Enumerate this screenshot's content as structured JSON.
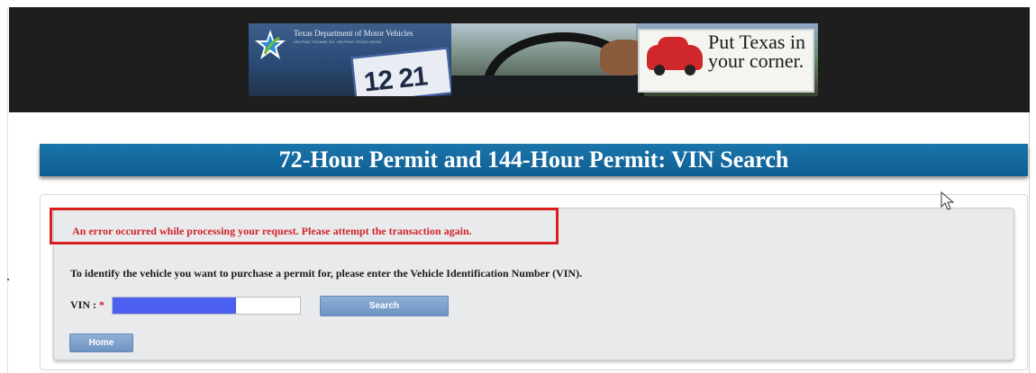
{
  "banner": {
    "agency_name": "Texas Department of Motor Vehicles",
    "agency_tagline": "HELPING TEXANS GO. HELPING TEXAS GROW.",
    "sticker_date": "12 21",
    "slogan": "Put Texas in your corner."
  },
  "page": {
    "title": "72-Hour Permit and 144-Hour Permit: VIN Search"
  },
  "form": {
    "error_message": "An error occurred while processing your request. Please attempt the transaction again.",
    "instruction": "To identify the vehicle you want to purchase a permit for, please enter the Vehicle Identification Number (VIN).",
    "vin_label": "VIN :",
    "required_marker": "*",
    "vin_value": "",
    "vin_redacted_fraction": 0.66,
    "search_label": "Search",
    "home_label": "Home"
  },
  "colors": {
    "title_bar": "#1569a0",
    "error_red": "#d91e1e",
    "button_blue": "#7a9fcc",
    "redaction_blue": "#4b5ff0"
  },
  "icons": {
    "logo": "txdmv-star-logo",
    "cursor": "mouse-pointer-icon"
  }
}
